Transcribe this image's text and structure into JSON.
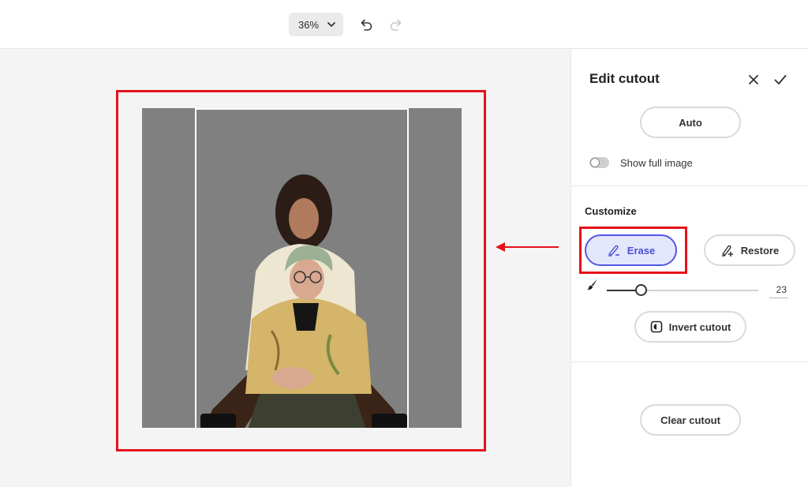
{
  "toolbar": {
    "zoom_value": "36%",
    "undo_icon": "undo-icon",
    "redo_icon": "redo-icon"
  },
  "panel": {
    "title": "Edit cutout",
    "close_icon": "close-icon",
    "confirm_icon": "check-icon",
    "auto_label": "Auto",
    "show_full_image_label": "Show full image",
    "show_full_image_on": false,
    "customize_title": "Customize",
    "erase_label": "Erase",
    "restore_label": "Restore",
    "brush_icon": "brush-icon",
    "brush_size": "23",
    "invert_label": "Invert cutout",
    "clear_label": "Clear cutout"
  },
  "colors": {
    "accent": "#5258e4",
    "accent_bg": "#e4e6fb",
    "annotation_red": "#e5111b",
    "cutout_background": "#808080"
  }
}
